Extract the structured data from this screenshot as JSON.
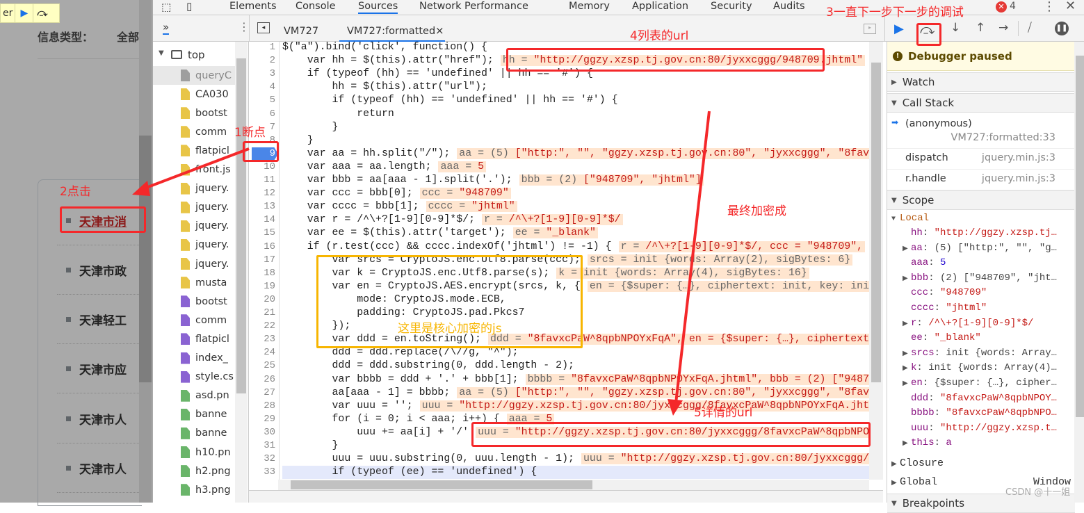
{
  "page": {
    "pause_label": "er",
    "info_type_label": "信息类型：",
    "info_type_value": "全部",
    "list_items": [
      "天津市消",
      "天津市政",
      "天津轻工",
      "天津市应",
      "天津市人",
      "天津市人"
    ]
  },
  "devtools": {
    "tabs": [
      "Elements",
      "Console",
      "Sources",
      "Network",
      "Performance",
      "Memory",
      "Application",
      "Security",
      "Audits"
    ],
    "active_tab": "Sources",
    "error_count": "4",
    "nav_more": "»",
    "editor_tabs": [
      "VM727",
      "VM727:formatted"
    ],
    "close_glyph": "×",
    "navigator": {
      "root": "top",
      "files": [
        {
          "name": "queryC",
          "type": "doc"
        },
        {
          "name": "CA030",
          "type": "js"
        },
        {
          "name": "bootst",
          "type": "js"
        },
        {
          "name": "comm",
          "type": "js"
        },
        {
          "name": "flatpicl",
          "type": "js"
        },
        {
          "name": "front.js",
          "type": "js"
        },
        {
          "name": "jquery.",
          "type": "js"
        },
        {
          "name": "jquery.",
          "type": "js"
        },
        {
          "name": "jquery.",
          "type": "js"
        },
        {
          "name": "jquery.",
          "type": "js"
        },
        {
          "name": "jquery.",
          "type": "js"
        },
        {
          "name": "musta",
          "type": "js"
        },
        {
          "name": "bootst",
          "type": "css"
        },
        {
          "name": "comm",
          "type": "css"
        },
        {
          "name": "flatpicl",
          "type": "css"
        },
        {
          "name": "index_",
          "type": "css"
        },
        {
          "name": "style.cs",
          "type": "css"
        },
        {
          "name": "asd.pn",
          "type": "img"
        },
        {
          "name": "banne",
          "type": "img"
        },
        {
          "name": "banne",
          "type": "img"
        },
        {
          "name": "h10.pn",
          "type": "img"
        },
        {
          "name": "h2.png",
          "type": "img"
        },
        {
          "name": "h3.png",
          "type": "img"
        }
      ]
    },
    "file_colors": {
      "doc": "#9e9e9e",
      "js": "#e8c547",
      "css": "#8a63d2",
      "img": "#6ab56a"
    }
  },
  "code": {
    "breakpoint_line": 9,
    "current_line": 33,
    "lines": [
      {
        "t": "$(\"a\").bind('click', function() {"
      },
      {
        "t": "    var hh = $(this).attr(\"href\");",
        "k": "hh = ",
        "v": "\"http://ggzy.xzsp.tj.gov.cn:80/jyxxcggg/948709.jhtml\""
      },
      {
        "t": "    if (typeof (hh) == 'undefined' || hh == '#') {"
      },
      {
        "t": "        hh = $(this).attr(\"url\");"
      },
      {
        "t": "        if (typeof (hh) == 'undefined' || hh == '#') {"
      },
      {
        "t": "            return"
      },
      {
        "t": "        }"
      },
      {
        "t": "    }"
      },
      {
        "t": "    var aa = hh.split(\"/\");",
        "k": "aa = (5) ",
        "v": "[\"http:\", \"\", \"ggzy.xzsp.tj.gov.cn:80\", \"jyxxcggg\", \"8fav"
      },
      {
        "t": "    var aaa = aa.length;",
        "k": "aaa = ",
        "v": "5"
      },
      {
        "t": "    var bbb = aa[aaa - 1].split('.');",
        "k": "bbb = (2) ",
        "v": "[\"948709\", \"jhtml\"]"
      },
      {
        "t": "    var ccc = bbb[0];",
        "k": "ccc = ",
        "v": "\"948709\""
      },
      {
        "t": "    var cccc = bbb[1];",
        "k": "cccc = ",
        "v": "\"jhtml\""
      },
      {
        "t": "    var r = /^\\+?[1-9][0-9]*$/;",
        "k": "r = ",
        "v": "/^\\+?[1-9][0-9]*$/"
      },
      {
        "t": "    var ee = $(this).attr('target');",
        "k": "ee = ",
        "v": "\"_blank\""
      },
      {
        "t": "    if (r.test(ccc) && cccc.indexOf('jhtml') != -1) {",
        "k": "r = ",
        "v": "/^\\+?[1-9][0-9]*$/, ccc = \"948709\","
      },
      {
        "t": "        var srcs = CryptoJS.enc.Utf8.parse(ccc);",
        "k": "srcs = init {words: Array(2), sigBytes: 6}",
        "v": ""
      },
      {
        "t": "        var k = CryptoJS.enc.Utf8.parse(s);",
        "k": "k = init {words: Array(4), sigBytes: 16}",
        "v": ""
      },
      {
        "t": "        var en = CryptoJS.AES.encrypt(srcs, k, {",
        "k": "en = {$super: {…}, ciphertext: init, key: ini",
        "v": ""
      },
      {
        "t": "            mode: CryptoJS.mode.ECB,"
      },
      {
        "t": "            padding: CryptoJS.pad.Pkcs7"
      },
      {
        "t": "        });"
      },
      {
        "t": "        var ddd = en.toString();",
        "k": "ddd = ",
        "v": "\"8favxcPaW^8qpbNPOYxFqA\", en = {$super: {…}, ciphertext"
      },
      {
        "t": "        ddd = ddd.replace(/\\//g, \"^\");"
      },
      {
        "t": "        ddd = ddd.substring(0, ddd.length - 2);"
      },
      {
        "t": "        var bbbb = ddd + '.' + bbb[1];",
        "k": "bbbb = ",
        "v": "\"8favxcPaW^8qpbNPOYxFqA.jhtml\", bbb = (2) [\"9487"
      },
      {
        "t": "        aa[aaa - 1] = bbbb;",
        "k": "aa = (5) ",
        "v": "[\"http:\", \"\", \"ggzy.xzsp.tj.gov.cn:80\", \"jyxxcggg\", \"8fav"
      },
      {
        "t": "        var uuu = '';",
        "k": "uuu = ",
        "v": "\"http://ggzy.xzsp.tj.gov.cn:80/jyxxcggg/8favxcPaW^8qpbNPOYxFqA.jht"
      },
      {
        "t": "        for (i = 0; i < aaa; i++) {",
        "k": "aaa = ",
        "v": "5"
      },
      {
        "t": "            uuu += aa[i] + '/'",
        "k": "uuu = ",
        "v": "\"http://ggzy.xzsp.tj.gov.cn:80/jyxxcggg/8favxcPaW^8qpbNPO"
      },
      {
        "t": "        }"
      },
      {
        "t": "        uuu = uuu.substring(0, uuu.length - 1);",
        "k": "uuu = ",
        "v": "\"http://ggzy.xzsp.tj.gov.cn:80/jyxxcggg/"
      },
      {
        "t": "        if (typeof (ee) == 'undefined') {"
      },
      {
        "t": ""
      }
    ]
  },
  "debugger": {
    "paused_text": "Debugger paused",
    "watch": "Watch",
    "call_stack": "Call Stack",
    "frames": [
      {
        "fn": "(anonymous)",
        "loc": "VM727:formatted:33"
      },
      {
        "fn": "dispatch",
        "loc": "jquery.min.js:3"
      },
      {
        "fn": "r.handle",
        "loc": "jquery.min.js:3"
      }
    ],
    "scope": "Scope",
    "local": "Local",
    "vars": [
      {
        "k": "hh",
        "v": "\"http://ggzy.xzsp.tj…",
        "exp": false,
        "c": "v"
      },
      {
        "k": "aa",
        "v": "(5) [\"http:\", \"\", \"g…",
        "exp": true,
        "c": "o"
      },
      {
        "k": "aaa",
        "v": "5",
        "exp": false,
        "c": "n"
      },
      {
        "k": "bbb",
        "v": "(2) [\"948709\", \"jht…",
        "exp": true,
        "c": "o"
      },
      {
        "k": "ccc",
        "v": "\"948709\"",
        "exp": false,
        "c": "v"
      },
      {
        "k": "cccc",
        "v": "\"jhtml\"",
        "exp": false,
        "c": "v"
      },
      {
        "k": "r",
        "v": "/^\\+?[1-9][0-9]*$/",
        "exp": true,
        "c": "v"
      },
      {
        "k": "ee",
        "v": "\"_blank\"",
        "exp": false,
        "c": "v"
      },
      {
        "k": "srcs",
        "v": "init {words: Array…",
        "exp": true,
        "c": "o"
      },
      {
        "k": "k",
        "v": "init {words: Array(4)…",
        "exp": true,
        "c": "o"
      },
      {
        "k": "en",
        "v": "{$super: {…}, cipher…",
        "exp": true,
        "c": "o"
      },
      {
        "k": "ddd",
        "v": "\"8favxcPaW^8qpbNPOY…",
        "exp": false,
        "c": "v"
      },
      {
        "k": "bbbb",
        "v": "\"8favxcPaW^8qpbNPO…",
        "exp": false,
        "c": "v"
      },
      {
        "k": "uuu",
        "v": "\"http://ggzy.xzsp.t…",
        "exp": false,
        "c": "v"
      },
      {
        "k": "this",
        "v": "a",
        "exp": true,
        "c": "k"
      }
    ],
    "closure": "Closure",
    "global": "Global",
    "global_value": "Window",
    "breakpoints": "Breakpoints"
  },
  "annotations": {
    "a1": "1断点",
    "a2": "2点击",
    "a3": "3一直下一步下一步的调试",
    "a4": "4列表的url",
    "a5": "5详情的url",
    "final": "最终加密成",
    "core": "这里是核心加密的js",
    "watermark": "CSDN @十一姐"
  },
  "colors": {
    "annotation_red": "#f4282a",
    "annotation_yellow": "#f7b500",
    "accent_blue": "#1a73e8"
  }
}
